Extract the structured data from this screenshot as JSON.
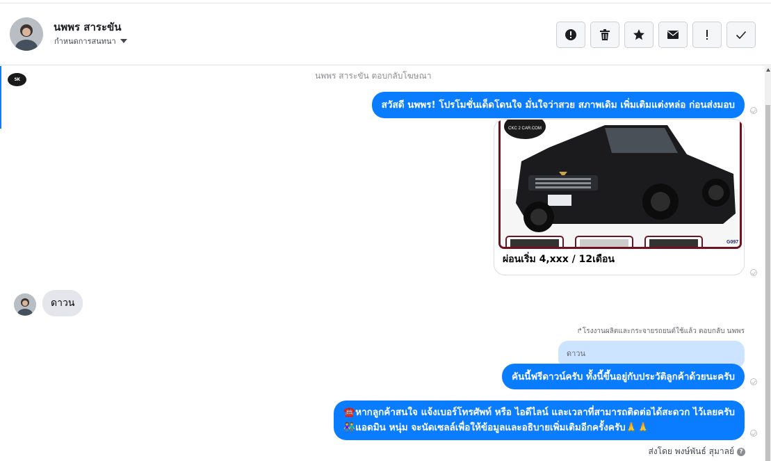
{
  "header": {
    "name": "นพพร สาระขัน",
    "status": "กำหนดการสนทนา",
    "actions": [
      {
        "icon": "alert-circle-icon"
      },
      {
        "icon": "trash-icon"
      },
      {
        "icon": "star-icon"
      },
      {
        "icon": "envelope-icon"
      },
      {
        "icon": "exclamation-icon"
      },
      {
        "icon": "checkmark-icon"
      }
    ]
  },
  "chat": {
    "page_logo_text": "SK",
    "ad_reply_note": "นพพร สาระขัน ตอบกลับโฆษณา",
    "msg1": "สวัสดี นพพร! โปรโมชั่นเด็ดโดนใจ มั่นใจว่าสวย สภาพเดิม เพิ่มเติมแต่งหล่อ ก่อนส่งมอบ",
    "card": {
      "brand": "CKC 2 CAR.COM",
      "code": "G097",
      "caption": "ผ่อนเริ่ม 4,xxx / 12เดือน"
    },
    "customer_reply": "ดาวน",
    "page_reply_note": "↱โรงงานผลิตและกระจายรถยนต์ใช้แล้ว ตอบกลับ นพพร",
    "quoted_text": "ดาวน",
    "msg2": "คันนี้ฟรีดาวน์ครับ ทั้งนี้ขึ้นอยู่กับประวัติลูกค้าด้วยนะครับ",
    "msg3_line1": "☎️หากลูกค้าสนใจ แจ้งเบอร์โทรศัพท์ หรือ ไอดีไลน์ และเวลาที่สามารถติดต่อได้สะดวก ไว้เลยครับ",
    "msg3_line2": "👫แอดมิน หนุ่ม จะนัดเซลล์เพื่อให้ข้อมูลและอธิบายเพิ่มเติมอีกครั้งครับ🙏🙏",
    "sent_by": "ส่งโดย พงษ์พันธ์ สุมาลย์",
    "help_mark": "?"
  },
  "colors": {
    "bubble_blue": "#0a7cff",
    "bubble_gray": "#e4e6eb",
    "quoted_bg": "#cce4ff",
    "accent": "#1877f2",
    "card_frame": "#6b1420"
  }
}
